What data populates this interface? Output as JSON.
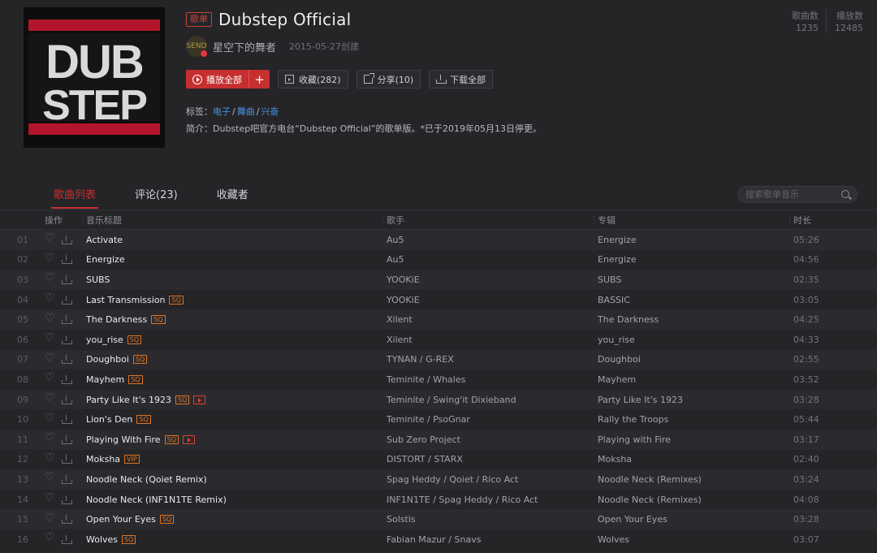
{
  "playlist": {
    "type_badge": "歌单",
    "title": "Dubstep Official",
    "creator": "星空下的舞者",
    "avatar_text": "SEND",
    "created": "2015-05-27创建",
    "tags_label": "标签：",
    "tags": [
      "电子",
      "舞曲",
      "兴奋"
    ],
    "desc_label": "简介：",
    "desc": "Dubstep吧官方电台“Dubstep Official”的歌单版。*已于2019年05月13日停更。",
    "cover_text_top": "DUB",
    "cover_text_bottom": "STEP"
  },
  "stats": {
    "songs_label": "歌曲数",
    "songs": "1235",
    "plays_label": "播放数",
    "plays": "12485"
  },
  "actions": {
    "play_all": "播放全部",
    "add": "+",
    "collect": "收藏(282)",
    "share": "分享(10)",
    "download": "下载全部"
  },
  "tabs": [
    "歌曲列表",
    "评论(23)",
    "收藏者"
  ],
  "search": {
    "placeholder": "搜索歌单音乐"
  },
  "columns": {
    "op": "操作",
    "title": "音乐标题",
    "artist": "歌手",
    "album": "专辑",
    "duration": "时长"
  },
  "songs": [
    {
      "num": "01",
      "title": "Activate",
      "artist": "Au5",
      "album": "Energize",
      "duration": "05:26",
      "badge": "",
      "mv": false
    },
    {
      "num": "02",
      "title": "Energize",
      "artist": "Au5",
      "album": "Energize",
      "duration": "04:56",
      "badge": "",
      "mv": false
    },
    {
      "num": "03",
      "title": "SUBS",
      "artist": "YOOKiE",
      "album": "SUBS",
      "duration": "02:35",
      "badge": "",
      "mv": false
    },
    {
      "num": "04",
      "title": "Last Transmission",
      "artist": "YOOKiE",
      "album": "BASSIC",
      "duration": "03:05",
      "badge": "SQ",
      "mv": false
    },
    {
      "num": "05",
      "title": "The Darkness",
      "artist": "Xilent",
      "album": "The Darkness",
      "duration": "04:25",
      "badge": "SQ",
      "mv": false
    },
    {
      "num": "06",
      "title": "you_rise",
      "artist": "Xilent",
      "album": "you_rise",
      "duration": "04:33",
      "badge": "SQ",
      "mv": false
    },
    {
      "num": "07",
      "title": "Doughboi",
      "artist": "TYNAN / G-REX",
      "album": "Doughboi",
      "duration": "02:55",
      "badge": "SQ",
      "mv": false
    },
    {
      "num": "08",
      "title": "Mayhem",
      "artist": "Teminite / Whales",
      "album": "Mayhem",
      "duration": "03:52",
      "badge": "SQ",
      "mv": false
    },
    {
      "num": "09",
      "title": "Party Like It's 1923",
      "artist": "Teminite / Swing'it Dixieband",
      "album": "Party Like It's 1923",
      "duration": "03:28",
      "badge": "SQ",
      "mv": true
    },
    {
      "num": "10",
      "title": "Lion's Den",
      "artist": "Teminite / PsoGnar",
      "album": "Rally the Troops",
      "duration": "05:44",
      "badge": "SQ",
      "mv": false
    },
    {
      "num": "11",
      "title": "Playing With Fire",
      "artist": "Sub Zero Project",
      "album": "Playing with Fire",
      "duration": "03:17",
      "badge": "SQ",
      "mv": true
    },
    {
      "num": "12",
      "title": "Moksha",
      "artist": "DISTORT / STARX",
      "album": "Moksha",
      "duration": "02:40",
      "badge": "VIP",
      "mv": false
    },
    {
      "num": "13",
      "title": "Noodle Neck (Qoiet Remix)",
      "artist": "Spag Heddy / Qoiet / Rico Act",
      "album": "Noodle Neck (Remixes)",
      "duration": "03:24",
      "badge": "",
      "mv": false
    },
    {
      "num": "14",
      "title": "Noodle Neck (INF1N1TE Remix)",
      "artist": "INF1N1TE / Spag Heddy / Rico Act",
      "album": "Noodle Neck (Remixes)",
      "duration": "04:08",
      "badge": "",
      "mv": false
    },
    {
      "num": "15",
      "title": "Open Your Eyes",
      "artist": "Solstis",
      "album": "Open Your Eyes",
      "duration": "03:28",
      "badge": "SQ",
      "mv": false
    },
    {
      "num": "16",
      "title": "Wolves",
      "artist": "Fabian Mazur / Snavs",
      "album": "Wolves",
      "duration": "03:07",
      "badge": "SQ",
      "mv": false
    }
  ]
}
